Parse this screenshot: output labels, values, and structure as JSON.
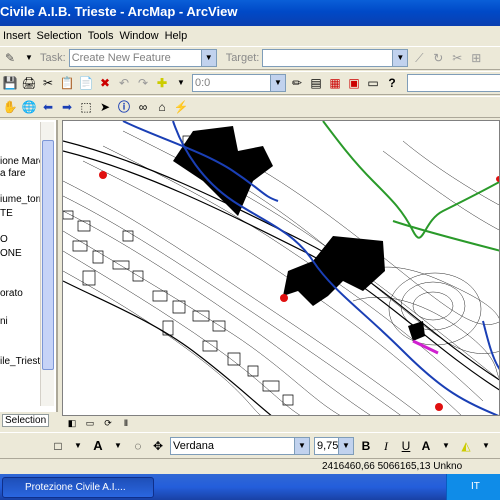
{
  "window": {
    "title": "Civile A.I.B. Trieste - ArcMap - ArcView"
  },
  "menu": [
    "Insert",
    "Selection",
    "Tools",
    "Window",
    "Help"
  ],
  "editor": {
    "task_label": "Task:",
    "task_value": "Create New Feature",
    "target_label": "Target:",
    "target_value": ""
  },
  "standard": {
    "scale_value": "0:0"
  },
  "toc": {
    "items": [
      "ione Marci",
      "a fare",
      "iume_torre",
      "TE",
      "O",
      "ONE",
      "orato",
      "ni",
      "ile_Trieste"
    ],
    "tab_label": "Selection"
  },
  "drawing": {
    "font_name": "Verdana",
    "font_size": "9,75"
  },
  "status": {
    "coords": "2416460,66  5066165,13 Unkno"
  },
  "taskbar": {
    "button_label": "Protezione Civile A.I....",
    "tray_lang": "IT"
  },
  "colors": {
    "map_black": "#000000",
    "green_line": "#2a9a2a",
    "blue_line": "#1a3fb5",
    "red_point": "#e01010",
    "magenta": "#d020d0"
  }
}
